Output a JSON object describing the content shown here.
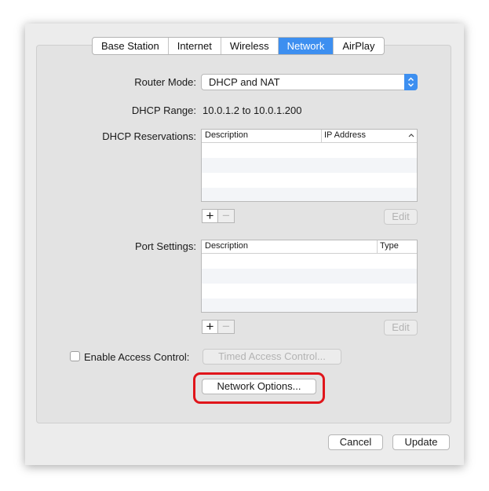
{
  "tabs": [
    {
      "label": "Base Station",
      "active": false
    },
    {
      "label": "Internet",
      "active": false
    },
    {
      "label": "Wireless",
      "active": false
    },
    {
      "label": "Network",
      "active": true
    },
    {
      "label": "AirPlay",
      "active": false
    }
  ],
  "router_mode": {
    "label": "Router Mode:",
    "value": "DHCP and NAT"
  },
  "dhcp_range": {
    "label": "DHCP Range:",
    "value": "10.0.1.2 to 10.0.1.200"
  },
  "dhcp_reservations": {
    "label": "DHCP Reservations:",
    "columns": [
      "Description",
      "IP Address"
    ],
    "add_label": "+",
    "remove_label": "−",
    "edit_label": "Edit"
  },
  "port_settings": {
    "label": "Port Settings:",
    "columns": [
      "Description",
      "Type"
    ],
    "add_label": "+",
    "remove_label": "−",
    "edit_label": "Edit"
  },
  "access_control": {
    "checkbox_label": "Enable Access Control:",
    "checked": false,
    "timed_button": "Timed Access Control..."
  },
  "network_options_button": "Network Options...",
  "footer": {
    "cancel_label": "Cancel",
    "update_label": "Update"
  },
  "colors": {
    "accent": "#3d8ff0",
    "highlight": "#e0151b"
  },
  "icons": {
    "select_stepper": "up-down-chevron-icon",
    "sort": "chevron-up-icon"
  }
}
